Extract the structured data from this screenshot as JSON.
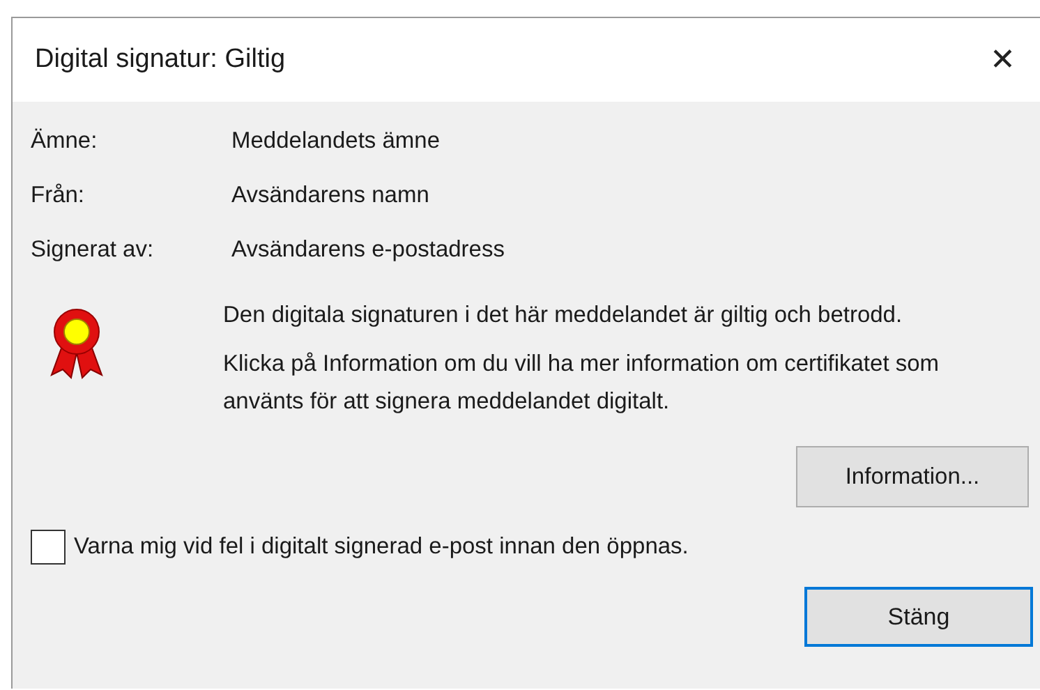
{
  "window": {
    "title": "Digital signatur: Giltig",
    "close": "✕"
  },
  "fields": [
    {
      "label": "Ämne:",
      "value": "Meddelandets ämne"
    },
    {
      "label": "Från:",
      "value": "Avsändarens namn"
    },
    {
      "label": "Signerat av:",
      "value": "Avsändarens e-postadress"
    }
  ],
  "message": [
    "Den digitala signaturen i det här meddelandet är giltig och betrodd.",
    "Klicka på Information om du vill ha mer information om certifikatet som använts för att signera meddelandet digitalt."
  ],
  "info_button": "Information...",
  "warn_checkbox": {
    "label": "Varna mig vid fel i digitalt signerad e-post innan den öppnas.",
    "checked": false
  },
  "close_button": "Stäng"
}
